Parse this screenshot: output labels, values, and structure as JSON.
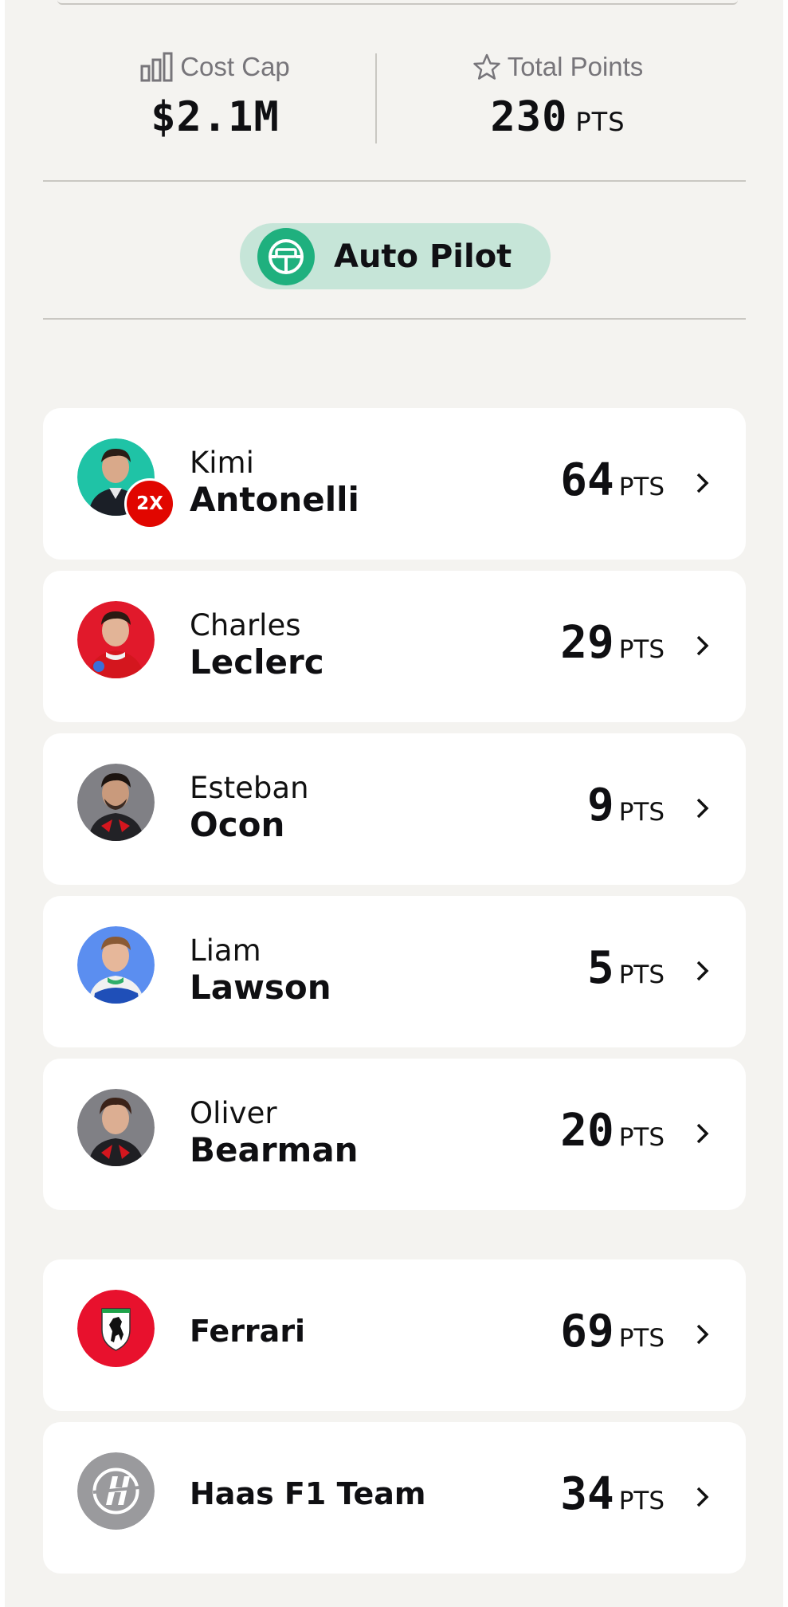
{
  "summary": {
    "cost_cap": {
      "label": "Cost Cap",
      "value": "$2.1M",
      "icon": "bar-chart-icon"
    },
    "total_points": {
      "label": "Total Points",
      "value": "230",
      "unit": "PTS",
      "icon": "star-icon"
    }
  },
  "autopilot": {
    "label": "Auto Pilot",
    "icon": "steering-wheel-icon"
  },
  "drivers": [
    {
      "first": "Kimi",
      "last": "Antonelli",
      "points": "64",
      "unit": "PTS",
      "badge": "2X",
      "avatar_color": "#1fc3a6"
    },
    {
      "first": "Charles",
      "last": "Leclerc",
      "points": "29",
      "unit": "PTS",
      "avatar_color": "#e1192b"
    },
    {
      "first": "Esteban",
      "last": "Ocon",
      "points": "9",
      "unit": "PTS",
      "avatar_color": "#808085"
    },
    {
      "first": "Liam",
      "last": "Lawson",
      "points": "5",
      "unit": "PTS",
      "avatar_color": "#5b8ef0"
    },
    {
      "first": "Oliver",
      "last": "Bearman",
      "points": "20",
      "unit": "PTS",
      "avatar_color": "#808085"
    }
  ],
  "teams": [
    {
      "name": "Ferrari",
      "points": "69",
      "unit": "PTS",
      "logo_color": "#e8112d",
      "icon": "prancing-horse-icon"
    },
    {
      "name": "Haas F1 Team",
      "points": "34",
      "unit": "PTS",
      "logo_color": "#9a9a9d",
      "icon": "haas-logo-icon"
    }
  ]
}
